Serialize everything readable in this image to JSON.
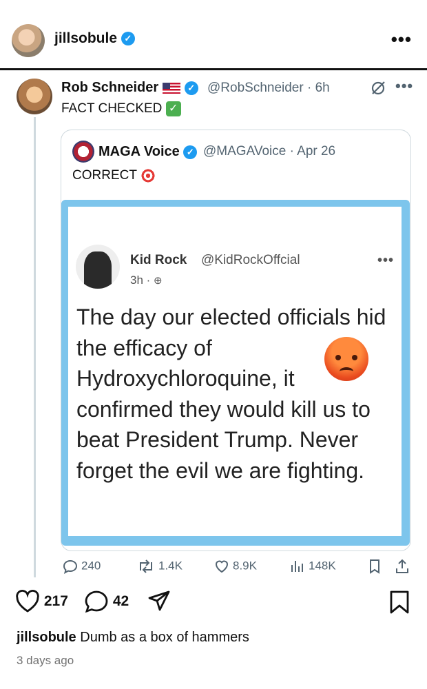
{
  "post": {
    "username": "jillsobule",
    "more": "•••",
    "likes": "217",
    "comments": "42",
    "caption_user": "jillsobule",
    "caption_text": "Dumb as a box of hammers",
    "time_ago": "3 days ago"
  },
  "tweet": {
    "author_name": "Rob Schneider",
    "author_handle": "@RobSchneider · 6h",
    "text": "FACT CHECKED",
    "more": "•••",
    "quote": {
      "author_name": "MAGA Voice",
      "author_handle": "@MAGAVoice · Apr 26",
      "text": "CORRECT"
    },
    "embedded": {
      "author_name": "Kid Rock",
      "author_handle": "@KidRockOffcial",
      "time": "3h ·",
      "more": "•••",
      "body": "The day our elected officials hid the efficacy of Hydroxychloroquine, it confirmed they would kill us to beat President Trump. Never forget the evil we are fighting."
    },
    "metrics": {
      "replies": "240",
      "reposts": "1.4K",
      "likes": "8.9K",
      "views": "148K"
    }
  },
  "colors": {
    "verified": "#1d9bf0",
    "muted": "#536471",
    "embed_border": "#7dc5ec"
  },
  "icons": [
    "verified-badge-icon",
    "us-flag-icon",
    "check-mark-emoji",
    "target-emoji",
    "angry-face-emoji",
    "reply-icon",
    "repost-icon",
    "like-icon",
    "views-icon",
    "bookmark-icon",
    "share-icon",
    "heart-icon",
    "comment-icon",
    "send-icon",
    "save-icon"
  ]
}
